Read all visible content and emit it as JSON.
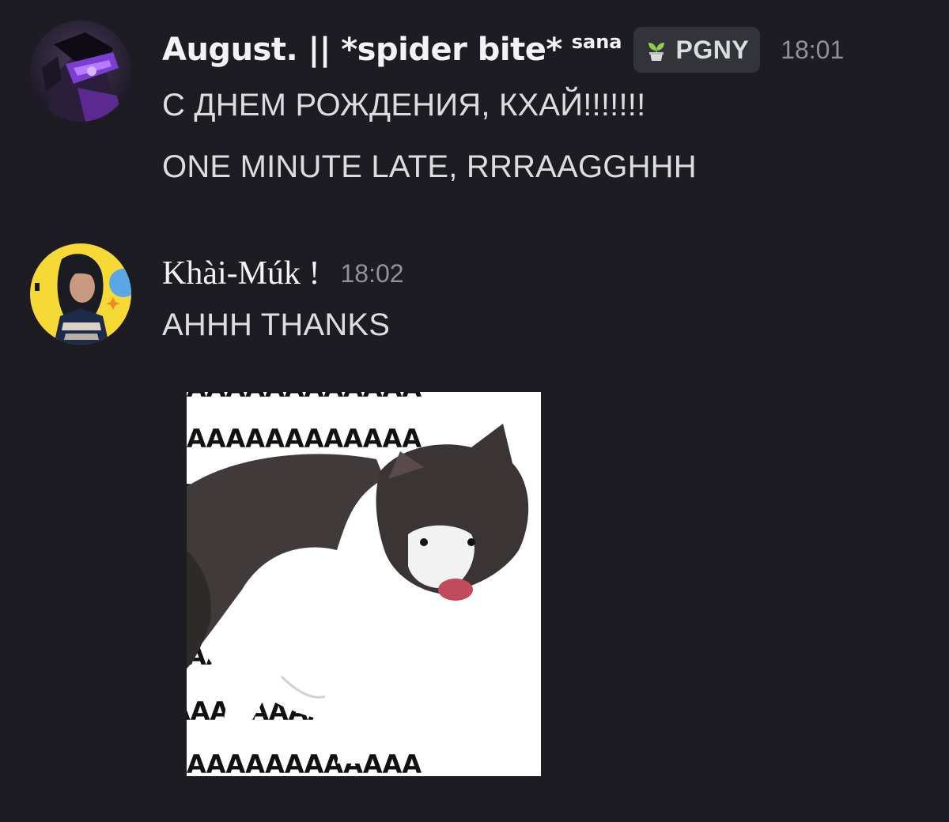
{
  "messages": [
    {
      "author": "August. || *spider bite*",
      "tag": "sana",
      "guild_badge": {
        "icon": "sprout-pot-icon",
        "label": "PGNY"
      },
      "time": "18:01",
      "lines": [
        "С ДНЕМ РОЖДЕНИЯ, КХАЙ!!!!!!!",
        "ONE MINUTE LATE, RRRAAGGHHH"
      ]
    },
    {
      "author": "Khài-Múk !",
      "time": "18:02",
      "lines": [
        "AHHH THANKS"
      ],
      "attachment": {
        "type": "cat-screaming-meme-image",
        "text": "AAAAAAAAAAAA"
      }
    }
  ],
  "colors": {
    "background": "#1c1c22",
    "username": "#f2f3f5",
    "message_text": "#dbdee1",
    "timestamp": "#8f9299",
    "badge_bg": "#33343a",
    "badge_icon": "#8bcf4f"
  }
}
